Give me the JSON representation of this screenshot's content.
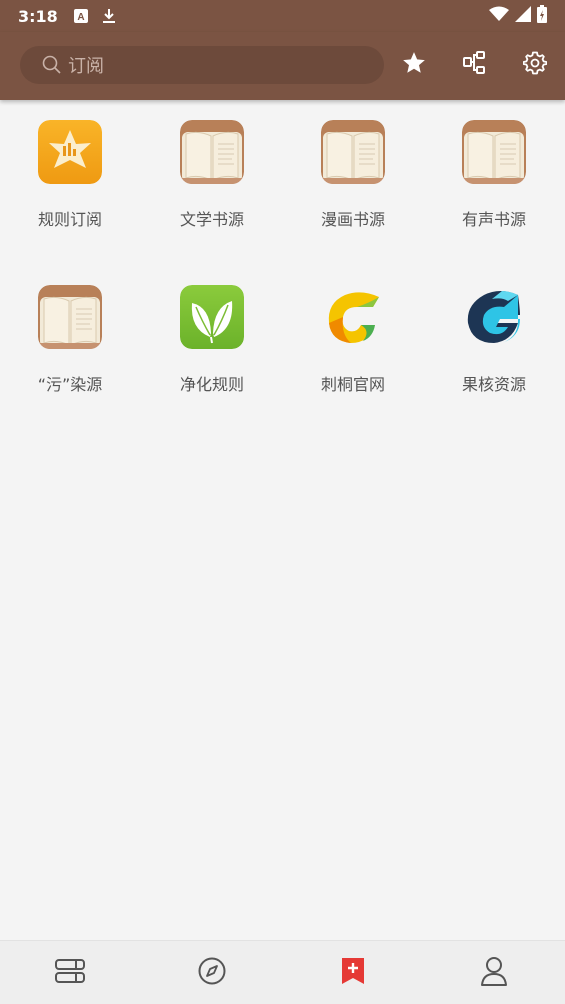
{
  "status": {
    "time": "3:18",
    "icons": [
      "font-a-icon",
      "download-icon",
      "wifi-icon",
      "signal-icon",
      "battery-charging-icon"
    ]
  },
  "appbar": {
    "search_placeholder": "订阅",
    "actions": [
      "star-icon",
      "group-tree-icon",
      "settings-gear-icon"
    ]
  },
  "grid": {
    "items": [
      {
        "label": "规则订阅",
        "icon": "rss-star-icon"
      },
      {
        "label": "文学书源",
        "icon": "open-book-icon"
      },
      {
        "label": "漫画书源",
        "icon": "open-book-icon"
      },
      {
        "label": "有声书源",
        "icon": "open-book-icon"
      },
      {
        "label": "“污”染源",
        "icon": "open-book-icon"
      },
      {
        "label": "净化规则",
        "icon": "leaf-icon"
      },
      {
        "label": "刺桐官网",
        "icon": "g-logo-yellow-icon"
      },
      {
        "label": "果核资源",
        "icon": "g-logo-blue-icon"
      }
    ]
  },
  "bottom_nav": {
    "items": [
      {
        "name": "bookshelf",
        "icon": "bookshelf-icon",
        "active": false
      },
      {
        "name": "discover",
        "icon": "compass-icon",
        "active": false
      },
      {
        "name": "subscription",
        "icon": "bookmark-plus-icon",
        "active": true
      },
      {
        "name": "my",
        "icon": "person-icon",
        "active": false
      }
    ]
  },
  "colors": {
    "appbar": "#7b5443",
    "search_bg": "#6d4a3b",
    "active_nav": "#e53935",
    "background": "#f4f4f4"
  }
}
